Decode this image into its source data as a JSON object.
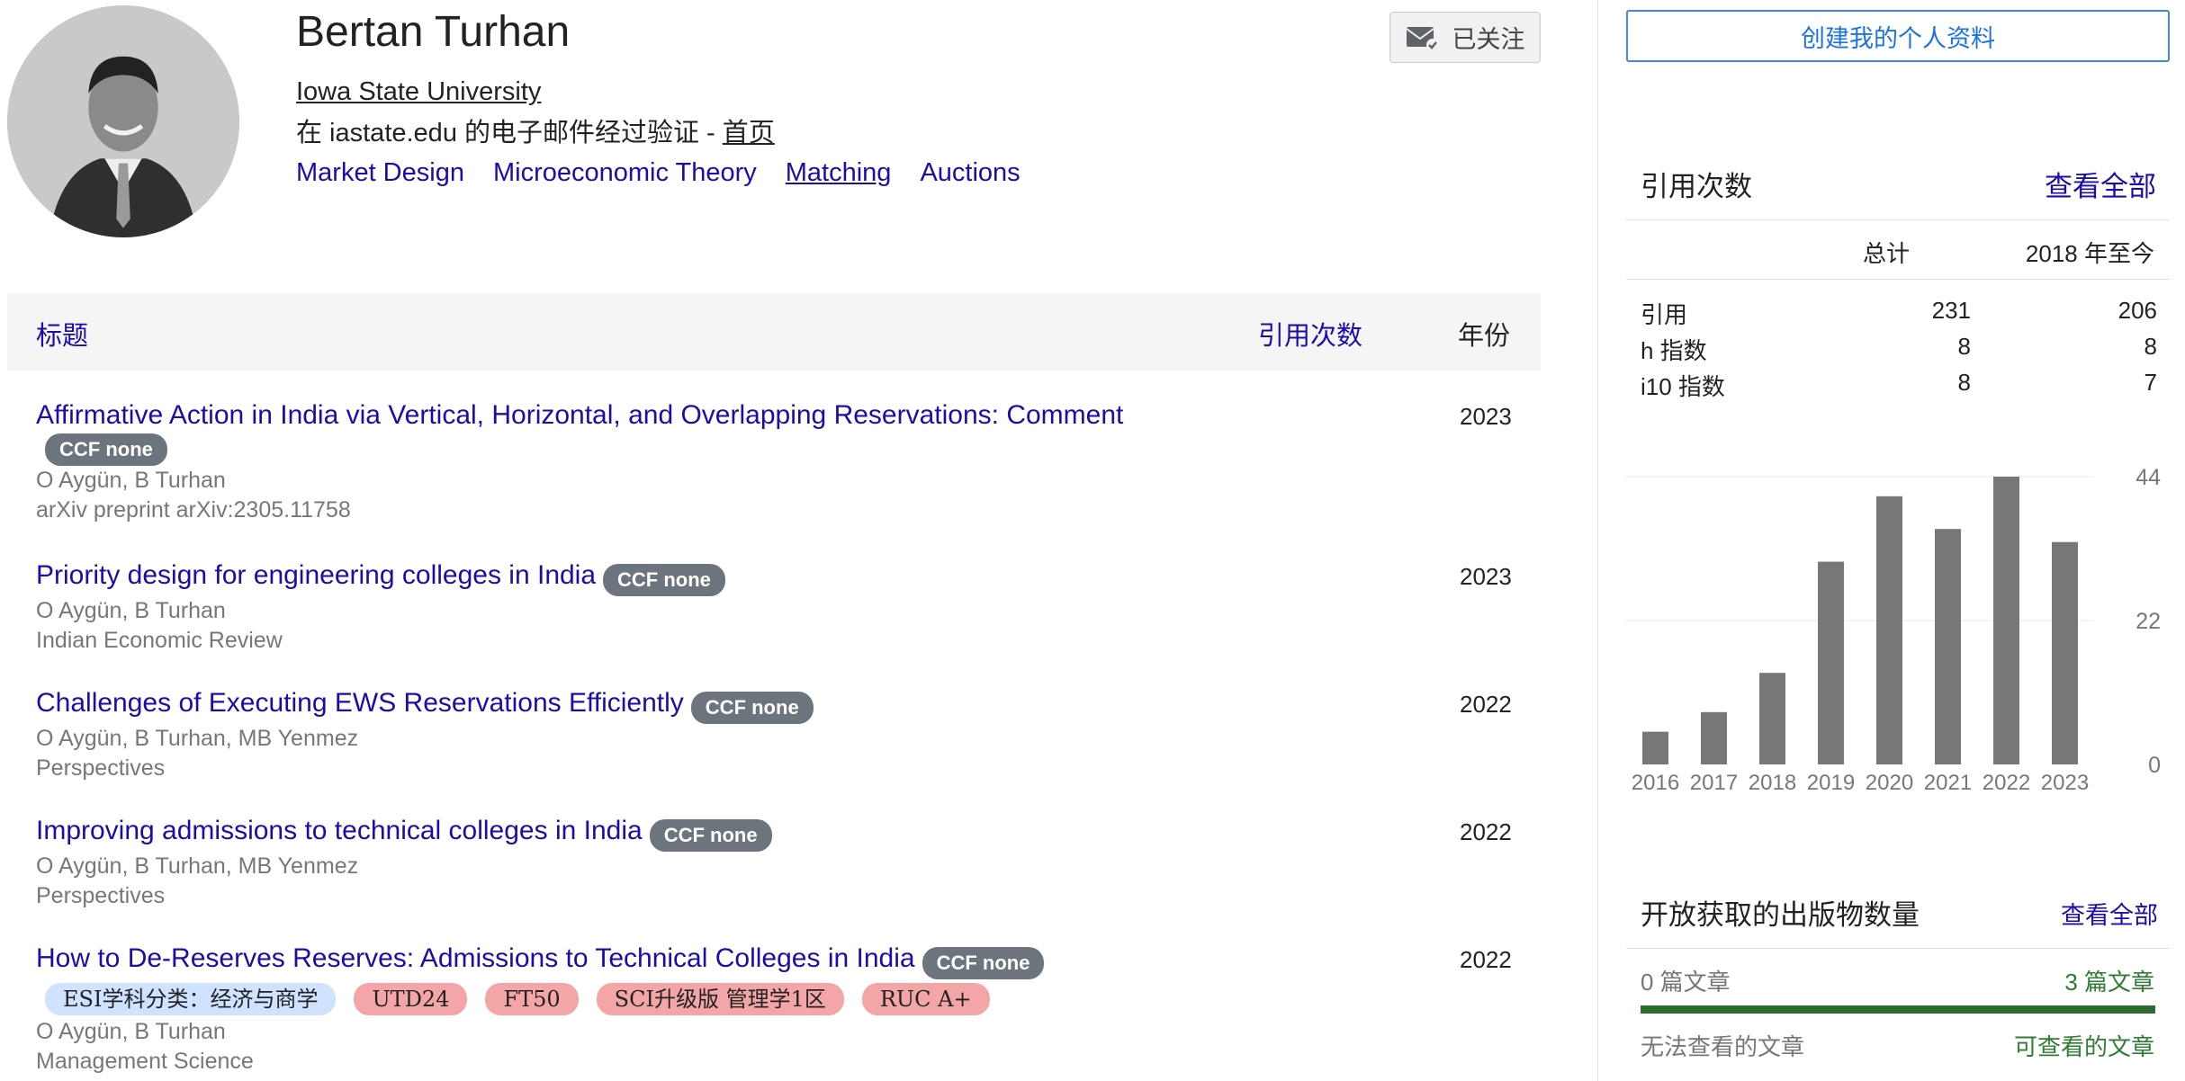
{
  "profile": {
    "name": "Bertan Turhan",
    "affiliation": "Iowa State University",
    "verified_prefix": "在 iastate.edu 的电子邮件经过验证 - ",
    "homepage_label": "首页",
    "interests": [
      "Market Design",
      "Microeconomic Theory",
      "Matching",
      "Auctions"
    ],
    "follow_label": "已关注"
  },
  "table": {
    "col_title": "标题",
    "col_cited": "引用次数",
    "col_year": "年份"
  },
  "publications": [
    {
      "title": "Affirmative Action in India via Vertical, Horizontal, and Overlapping Reservations: Comment",
      "badge": "CCF none",
      "authors": "O Aygün, B Turhan",
      "venue": "arXiv preprint arXiv:2305.11758",
      "year": "2023"
    },
    {
      "title": "Priority design for engineering colleges in India",
      "badge": "CCF none",
      "authors": "O Aygün, B Turhan",
      "venue": "Indian Economic Review",
      "year": "2023"
    },
    {
      "title": "Challenges of Executing EWS Reservations Efficiently",
      "badge": "CCF none",
      "authors": "O Aygün, B Turhan, MB Yenmez",
      "venue": "Perspectives",
      "year": "2022"
    },
    {
      "title": "Improving admissions to technical colleges in India",
      "badge": "CCF none",
      "authors": "O Aygün, B Turhan, MB Yenmez",
      "venue": "Perspectives",
      "year": "2022"
    },
    {
      "title": "How to De-Reserves Reserves: Admissions to Technical Colleges in India",
      "badge": "CCF none",
      "tags": [
        "ESI学科分类：经济与商学",
        "UTD24",
        "FT50",
        "SCI升级版 管理学1区",
        "RUC A+"
      ],
      "authors": "O Aygün, B Turhan",
      "venue": "Management Science",
      "year": "2022"
    }
  ],
  "sidebar": {
    "create_profile": "创建我的个人资料",
    "cited_by": {
      "title": "引用次数",
      "view_all": "查看全部",
      "col_total": "总计",
      "col_since": "2018 年至今",
      "rows": [
        {
          "label": "引用",
          "total": "231",
          "since": "206"
        },
        {
          "label": "h 指数",
          "total": "8",
          "since": "8"
        },
        {
          "label": "i10 指数",
          "total": "8",
          "since": "7"
        }
      ]
    },
    "open_access": {
      "title": "开放获取的出版物数量",
      "view_all": "查看全部",
      "left_count": "0 篇文章",
      "right_count": "3 篇文章",
      "left_label": "无法查看的文章",
      "right_label": "可查看的文章",
      "fill_fraction": 1.0,
      "fill_color": "#2e6b2e"
    }
  },
  "chart_data": {
    "type": "bar",
    "categories": [
      "2016",
      "2017",
      "2018",
      "2019",
      "2020",
      "2021",
      "2022",
      "2023"
    ],
    "values": [
      5,
      8,
      14,
      31,
      41,
      36,
      44,
      34
    ],
    "ylim": [
      0,
      44
    ],
    "yticks": [
      "0",
      "22",
      "44"
    ],
    "bar_color": "#777777",
    "grid": true
  }
}
